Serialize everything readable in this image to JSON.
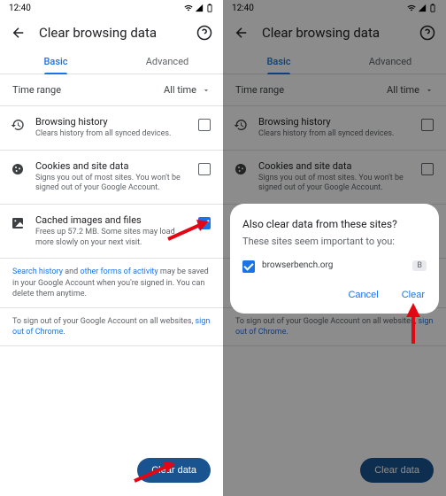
{
  "statusbar": {
    "time": "12:40"
  },
  "header": {
    "title": "Clear browsing data"
  },
  "tabs": {
    "basic": "Basic",
    "advanced": "Advanced"
  },
  "time_range": {
    "label": "Time range",
    "value": "All time"
  },
  "options": {
    "history": {
      "title": "Browsing history",
      "desc": "Clears history from all synced devices."
    },
    "cookies": {
      "title": "Cookies and site data",
      "desc": "Signs you out of most sites. You won't be signed out of your Google Account."
    },
    "cache": {
      "title": "Cached images and files",
      "desc": "Frees up 57.2 MB. Some sites may load more slowly on your next visit."
    }
  },
  "info1": {
    "prefix": "Search history",
    "mid": " and ",
    "link": "other forms of activity",
    "rest": " may be saved in your Google Account when you're signed in. You can delete them anytime."
  },
  "info2": {
    "prefix": "To sign out of your Google Account on all websites, ",
    "link": "sign out of Chrome",
    "suffix": "."
  },
  "clear_button": "Clear data",
  "dialog": {
    "title": "Also clear data from these sites?",
    "subtitle": "These sites seem important to you:",
    "site": "browserbench.org",
    "badge": "B",
    "cancel": "Cancel",
    "clear": "Clear"
  }
}
